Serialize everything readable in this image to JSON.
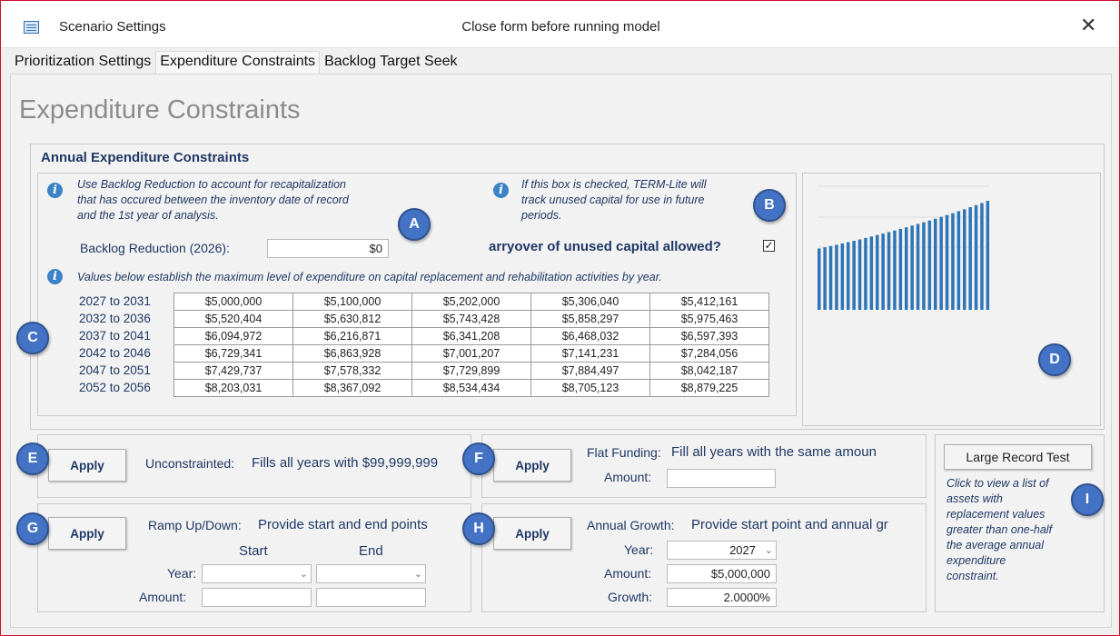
{
  "window": {
    "title": "Scenario Settings",
    "center_message": "Close form before running model",
    "close_glyph": "✕"
  },
  "tabs": [
    {
      "label": "Prioritization Settings",
      "active": false
    },
    {
      "label": "Expenditure Constraints",
      "active": true
    },
    {
      "label": "Backlog Target Seek",
      "active": false
    }
  ],
  "page_title": "Expenditure Constraints",
  "annual": {
    "section_title": "Annual Expenditure Constraints",
    "backlog_note": [
      "Use Backlog Reduction to account for recapitalization",
      "that has occured between the inventory date of record",
      "and the 1st year of analysis."
    ],
    "backlog_label": "Backlog Reduction (2026):",
    "backlog_value": "$0",
    "carry_note": [
      "If this box is checked, TERM-Lite will",
      "track unused capital for use in future",
      "periods."
    ],
    "carry_label": "arryover of unused capital allowed?",
    "carry_checked": "☑",
    "values_note": "Values below establish the maximum level of expenditure on capital replacement and rehabilitation activities by year.",
    "rows": [
      {
        "label": "2027 to 2031",
        "values": [
          "$5,000,000",
          "$5,100,000",
          "$5,202,000",
          "$5,306,040",
          "$5,412,161"
        ]
      },
      {
        "label": "2032 to 2036",
        "values": [
          "$5,520,404",
          "$5,630,812",
          "$5,743,428",
          "$5,858,297",
          "$5,975,463"
        ]
      },
      {
        "label": "2037 to 2041",
        "values": [
          "$6,094,972",
          "$6,216,871",
          "$6,341,208",
          "$6,468,032",
          "$6,597,393"
        ]
      },
      {
        "label": "2042 to 2046",
        "values": [
          "$6,729,341",
          "$6,863,928",
          "$7,001,207",
          "$7,141,231",
          "$7,284,056"
        ]
      },
      {
        "label": "2047 to 2051",
        "values": [
          "$7,429,737",
          "$7,578,332",
          "$7,729,899",
          "$7,884,497",
          "$8,042,187"
        ]
      },
      {
        "label": "2052 to 2056",
        "values": [
          "$8,203,031",
          "$8,367,092",
          "$8,534,434",
          "$8,705,123",
          "$8,879,225"
        ]
      }
    ]
  },
  "chart_data": {
    "type": "bar",
    "title": "",
    "xlabel": "",
    "ylabel": "",
    "ylim": [
      0,
      10000000
    ],
    "bar_color": "#2e75b6",
    "values": [
      5000000,
      5100000,
      5202000,
      5306040,
      5412161,
      5520404,
      5630812,
      5743428,
      5858297,
      5975463,
      6094972,
      6216871,
      6341208,
      6468032,
      6597393,
      6729341,
      6863928,
      7001207,
      7141231,
      7284056,
      7429737,
      7578332,
      7729899,
      7884497,
      8042187,
      8203031,
      8367092,
      8534434,
      8705123,
      8879225
    ]
  },
  "apply_label": "Apply",
  "unconstrained": {
    "title": "Unconstrainted:",
    "desc": "Fills all years with $99,999,999"
  },
  "flat": {
    "title": "Flat Funding:",
    "desc": "Fill all years with the same amoun",
    "amount_label": "Amount:",
    "amount_value": ""
  },
  "ramp": {
    "title": "Ramp Up/Down:",
    "desc": "Provide start and end points",
    "start_label": "Start",
    "end_label": "End",
    "year_label": "Year:",
    "amount_label": "Amount:"
  },
  "growth": {
    "title": "Annual Growth:",
    "desc": "Provide start point and annual gr",
    "year_label": "Year:",
    "year_value": "2027",
    "amount_label": "Amount:",
    "amount_value": "$5,000,000",
    "growth_label": "Growth:",
    "growth_value": "2.0000%"
  },
  "large_record": {
    "button": "Large Record Test",
    "note": [
      "Click to view a list of",
      "assets with",
      "replacement values",
      "greater than one-half",
      "the average annual",
      "expenditure",
      "constraint."
    ]
  },
  "badges": [
    "A",
    "B",
    "C",
    "D",
    "E",
    "F",
    "G",
    "H",
    "I"
  ],
  "colors": {
    "badge": "#4472c4",
    "label_text": "#1f3864",
    "info_icon": "#3b83c6"
  }
}
